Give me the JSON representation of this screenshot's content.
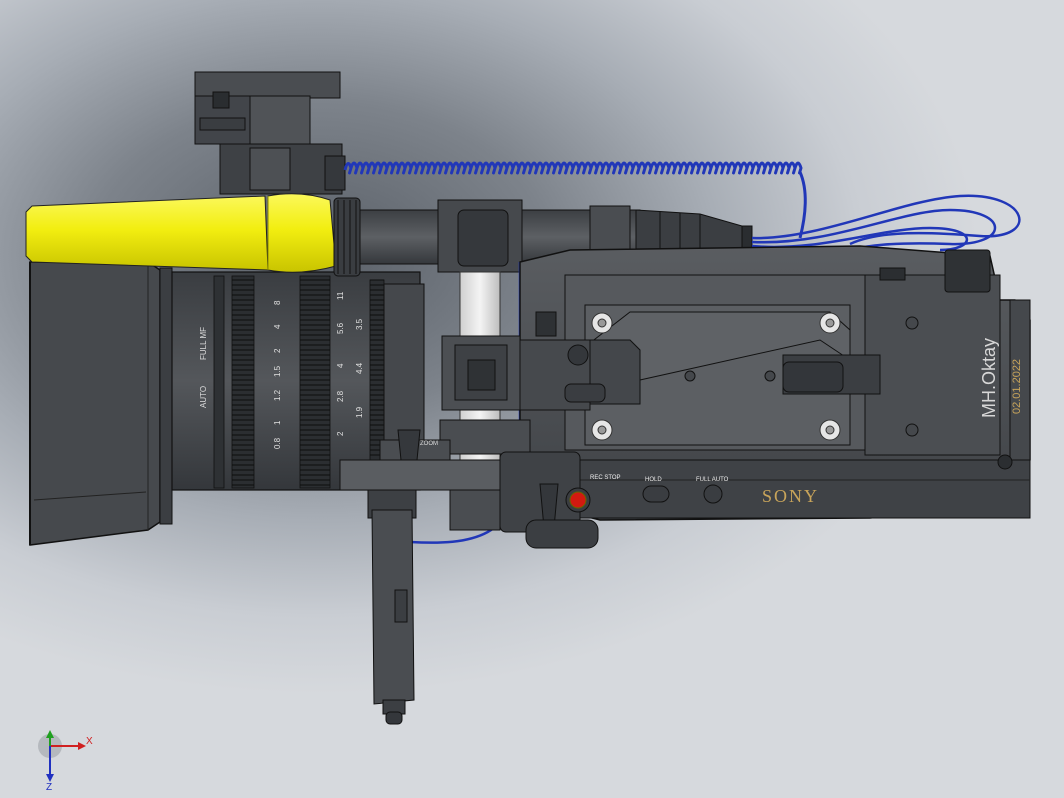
{
  "model": {
    "brand_label": "SONY",
    "author_label": "MH.Oktay",
    "date_label": "02.01.2022",
    "lens_scale_full_mf": "FULL MF",
    "lens_scale_auto_mf": "AUTO",
    "lens_iris_values": [
      "11",
      "5.6",
      "4",
      "2.8",
      "2"
    ],
    "lens_focus_values": [
      "8",
      "4",
      "2",
      "1.5",
      "1.2",
      "1",
      "0.8"
    ],
    "lens_zoom_values": [
      "3.5",
      "4.4",
      "1.9"
    ],
    "button_rec_stop": "REC STOP",
    "button_hold": "HOLD",
    "button_full_auto": "FULL AUTO",
    "grip_label": "ZOOM"
  },
  "triad": {
    "x_label": "X",
    "z_label": "Z"
  },
  "colors": {
    "mic_yellow": "#f2ee10",
    "cable_blue": "#2137b8",
    "rec_red": "#d21a10",
    "body_dark": "#4b4e52",
    "brand_gold": "#c8a45a"
  }
}
